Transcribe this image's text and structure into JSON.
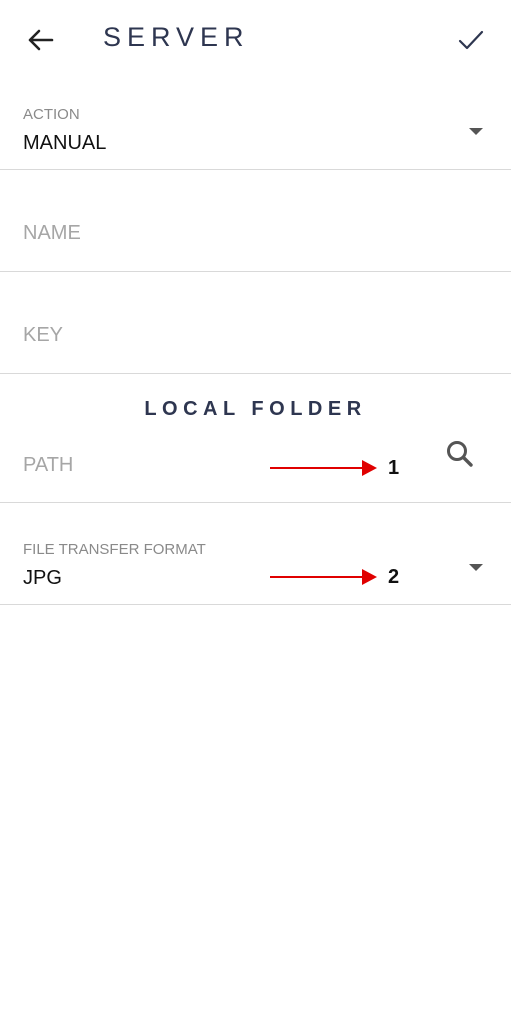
{
  "header": {
    "title": "SERVER",
    "back_icon": "arrow-left-icon",
    "confirm_icon": "check-icon"
  },
  "form": {
    "action": {
      "label": "ACTION",
      "value": "MANUAL"
    },
    "name": {
      "placeholder": "NAME",
      "value": ""
    },
    "key": {
      "placeholder": "KEY",
      "value": ""
    },
    "local_folder": {
      "section_title": "LOCAL FOLDER",
      "path_placeholder": "PATH",
      "search_icon": "search-icon"
    },
    "file_transfer_format": {
      "label": "FILE TRANSFER FORMAT",
      "value": "JPG"
    }
  },
  "annotations": [
    {
      "label": "1"
    },
    {
      "label": "2"
    }
  ],
  "colors": {
    "title": "#2e3650",
    "annotation_arrow": "#e00000",
    "divider": "#d9d9d9"
  }
}
